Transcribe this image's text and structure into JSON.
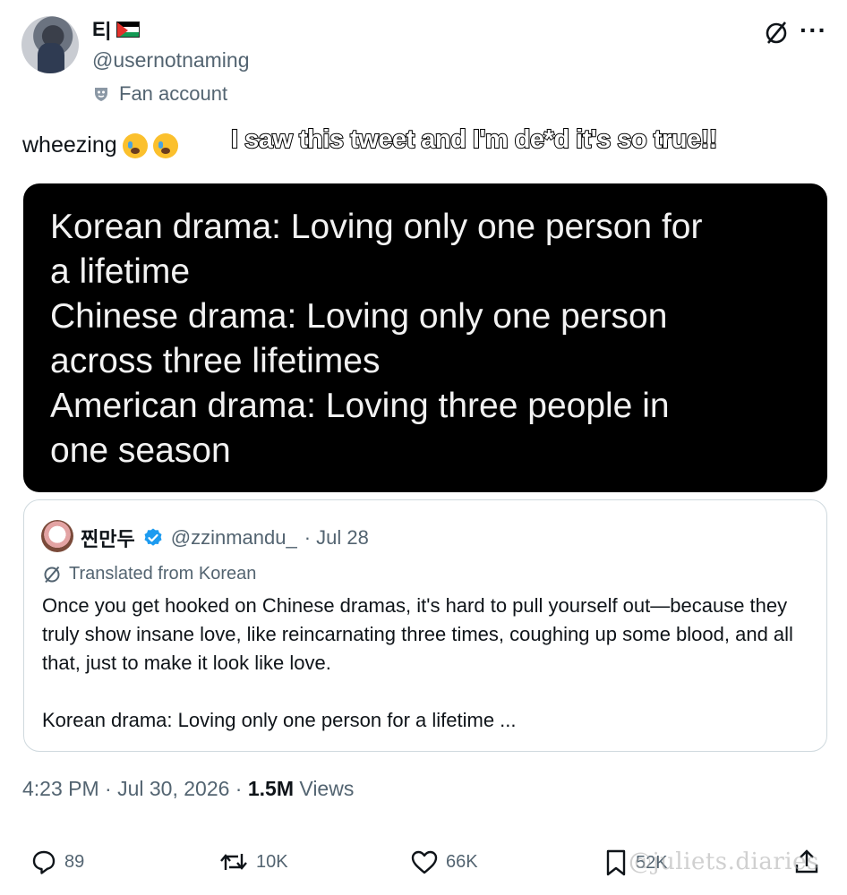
{
  "author": {
    "display_name": "E|",
    "handle": "@usernotnaming",
    "badge": "Fan account"
  },
  "tweet": {
    "text": "wheezing"
  },
  "overlay_caption": "I saw this tweet and I'm de*d it's so true!!",
  "image_card": {
    "lines": [
      "Korean drama: Loving only one person for",
      "a lifetime",
      "Chinese drama: Loving only one person",
      "across three lifetimes",
      "American drama: Loving three people in",
      "one season"
    ]
  },
  "quote": {
    "name": "찐만두",
    "handle": "@zzinmandu_",
    "date": "· Jul 28",
    "translated_label": "Translated from Korean",
    "paragraph_1": "Once you get hooked on Chinese dramas, it's hard to pull yourself out—because they truly show insane love, like reincarnating three times, coughing up some blood, and all that, just to make it look like love.",
    "paragraph_2": "Korean drama: Loving only one person for a lifetime  ..."
  },
  "meta": {
    "time": "4:23 PM · Jul 30, 2026 · ",
    "views_count": "1.5M",
    "views_label": " Views"
  },
  "actions": {
    "replies": "89",
    "reposts": "10K",
    "likes": "66K",
    "bookmarks": "52K"
  },
  "watermark": "@juliets.diaries",
  "colors": {
    "muted": "#536471",
    "text": "#0f1419",
    "verified": "#1d9bf0",
    "border": "#cfd9de"
  },
  "icons": [
    "translate-icon",
    "more-icon",
    "fan-mask-icon",
    "verified-icon",
    "reply-icon",
    "repost-icon",
    "like-icon",
    "bookmark-icon",
    "share-icon"
  ]
}
